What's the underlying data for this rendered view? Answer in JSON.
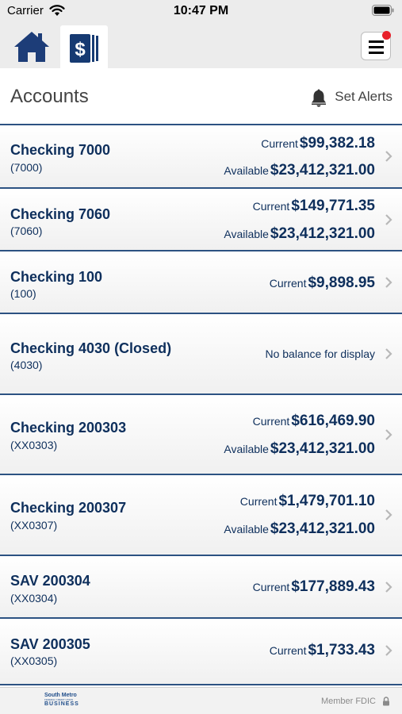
{
  "status_bar": {
    "carrier": "Carrier",
    "time": "10:47 PM"
  },
  "header": {
    "title": "Accounts",
    "alerts_label": "Set Alerts"
  },
  "labels": {
    "current": "Current",
    "available": "Available"
  },
  "accounts": [
    {
      "name": "Checking 7000",
      "number": "(7000)",
      "current": "$99,382.18",
      "available": "$23,412,321.00"
    },
    {
      "name": "Checking 7060",
      "number": "(7060)",
      "current": "$149,771.35",
      "available": "$23,412,321.00"
    },
    {
      "name": "Checking 100",
      "number": "(100)",
      "current": "$9,898.95"
    },
    {
      "name": "Checking 4030 (Closed)",
      "number": "(4030)",
      "no_balance": "No balance for display"
    },
    {
      "name": "Checking 200303",
      "number": "(XX0303)",
      "current": "$616,469.90",
      "available": "$23,412,321.00"
    },
    {
      "name": "Checking 200307",
      "number": "(XX0307)",
      "current": "$1,479,701.10",
      "available": "$23,412,321.00"
    },
    {
      "name": "SAV 200304",
      "number": "(XX0304)",
      "current": "$177,889.43"
    },
    {
      "name": "SAV 200305",
      "number": "(XX0305)",
      "current": "$1,733.43"
    }
  ],
  "footer": {
    "logo_line1": "South Metro",
    "logo_line2": "FEDERAL CREDIT UNION",
    "logo_line3": "BUSINESS",
    "member_fdic": "Member FDIC"
  },
  "icons": {
    "wifi": "wifi-icon",
    "battery": "battery-icon",
    "home": "home-icon",
    "accounts": "dollar-cards-icon",
    "menu": "hamburger-menu-icon",
    "bell": "bell-icon",
    "chevron": "chevron-right-icon",
    "lock": "lock-icon"
  },
  "colors": {
    "primary_navy": "#0e2f5c",
    "divider_blue": "#2c5282",
    "notification_red": "#e8202a",
    "chrome_gray": "#ececec"
  }
}
